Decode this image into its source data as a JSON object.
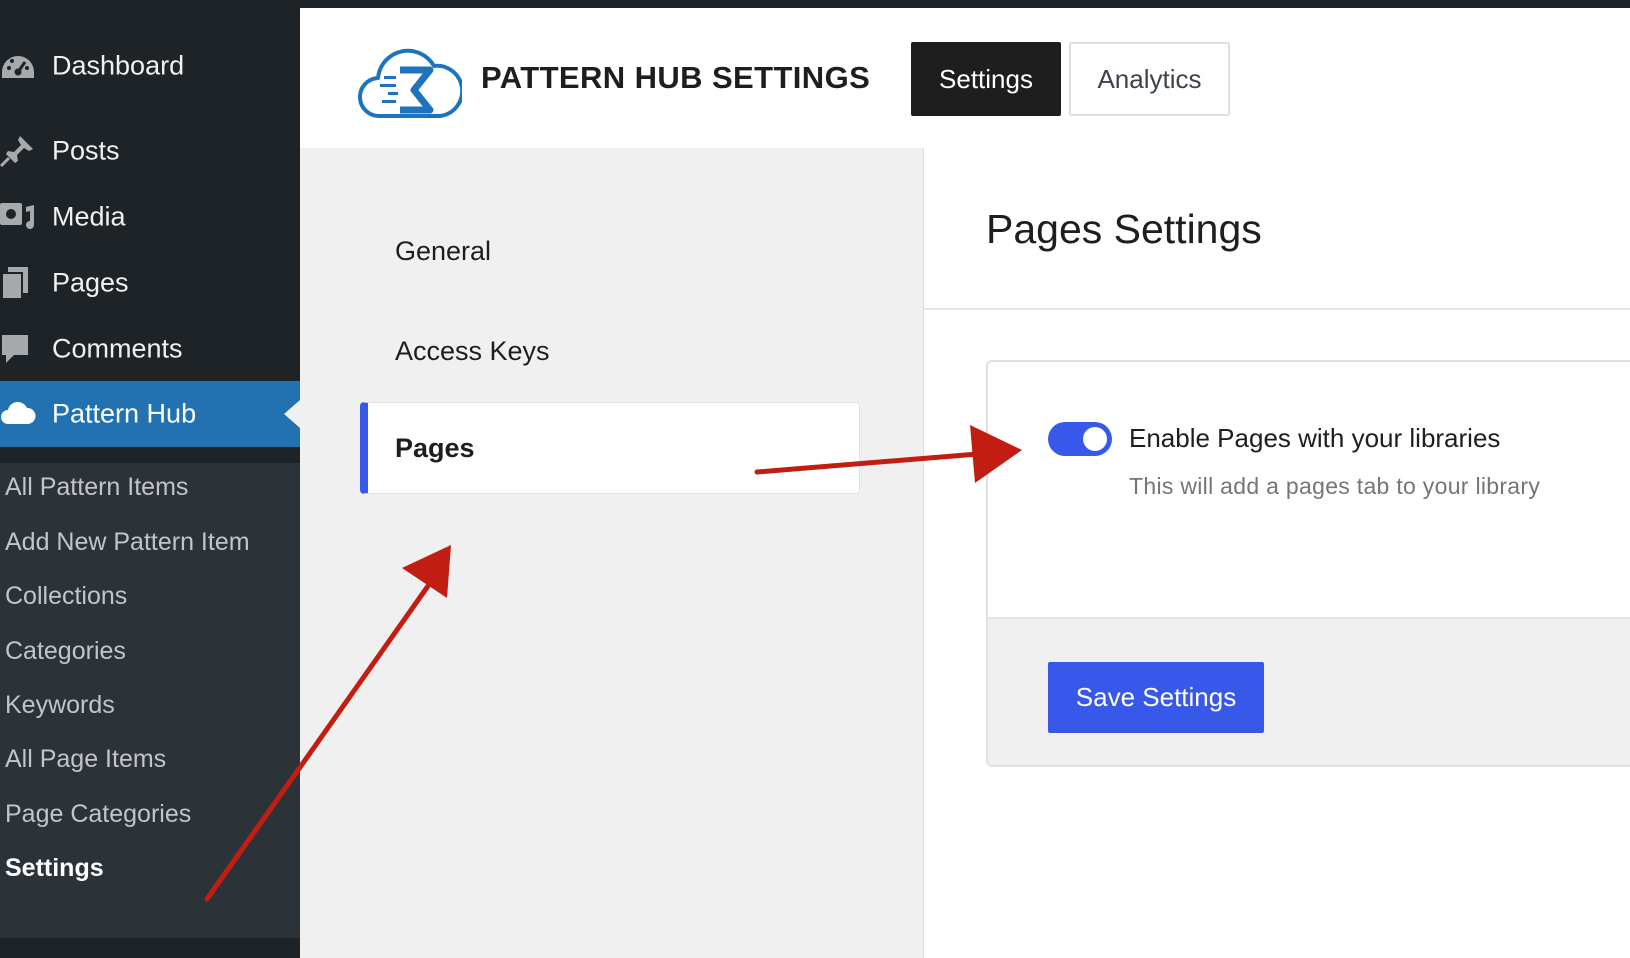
{
  "sidebar": {
    "menu": [
      {
        "label": "Dashboard",
        "icon": "dashboard-icon"
      },
      {
        "label": "Posts",
        "icon": "pin-icon"
      },
      {
        "label": "Media",
        "icon": "media-icon"
      },
      {
        "label": "Pages",
        "icon": "pages-icon"
      },
      {
        "label": "Comments",
        "icon": "comment-icon"
      },
      {
        "label": "Pattern Hub",
        "icon": "cloud-icon",
        "active": true
      }
    ],
    "submenu": [
      "All Pattern Items",
      "Add New Pattern Item",
      "Collections",
      "Categories",
      "Keywords",
      "All Page Items",
      "Page Categories",
      "Settings"
    ],
    "current_submenu": "Settings"
  },
  "header": {
    "brand": "PATTERN HUB SETTINGS",
    "logo_icon": "cloud-k-logo",
    "tabs": [
      {
        "label": "Settings",
        "active": true
      },
      {
        "label": "Analytics",
        "active": false
      }
    ]
  },
  "settings_nav": {
    "items": [
      {
        "label": "General"
      },
      {
        "label": "Access Keys"
      },
      {
        "label": "Pages",
        "active": true
      }
    ]
  },
  "content": {
    "title": "Pages Settings",
    "toggle": {
      "label": "Enable Pages with your libraries",
      "help": "This will add a pages tab to your library",
      "enabled": true
    },
    "save_label": "Save Settings"
  },
  "colors": {
    "sidebar_bg": "#1d2327",
    "submenu_bg": "#2c3338",
    "active_menu": "#2271b1",
    "accent": "#3858e9",
    "annotation_arrow": "#c21d12"
  }
}
